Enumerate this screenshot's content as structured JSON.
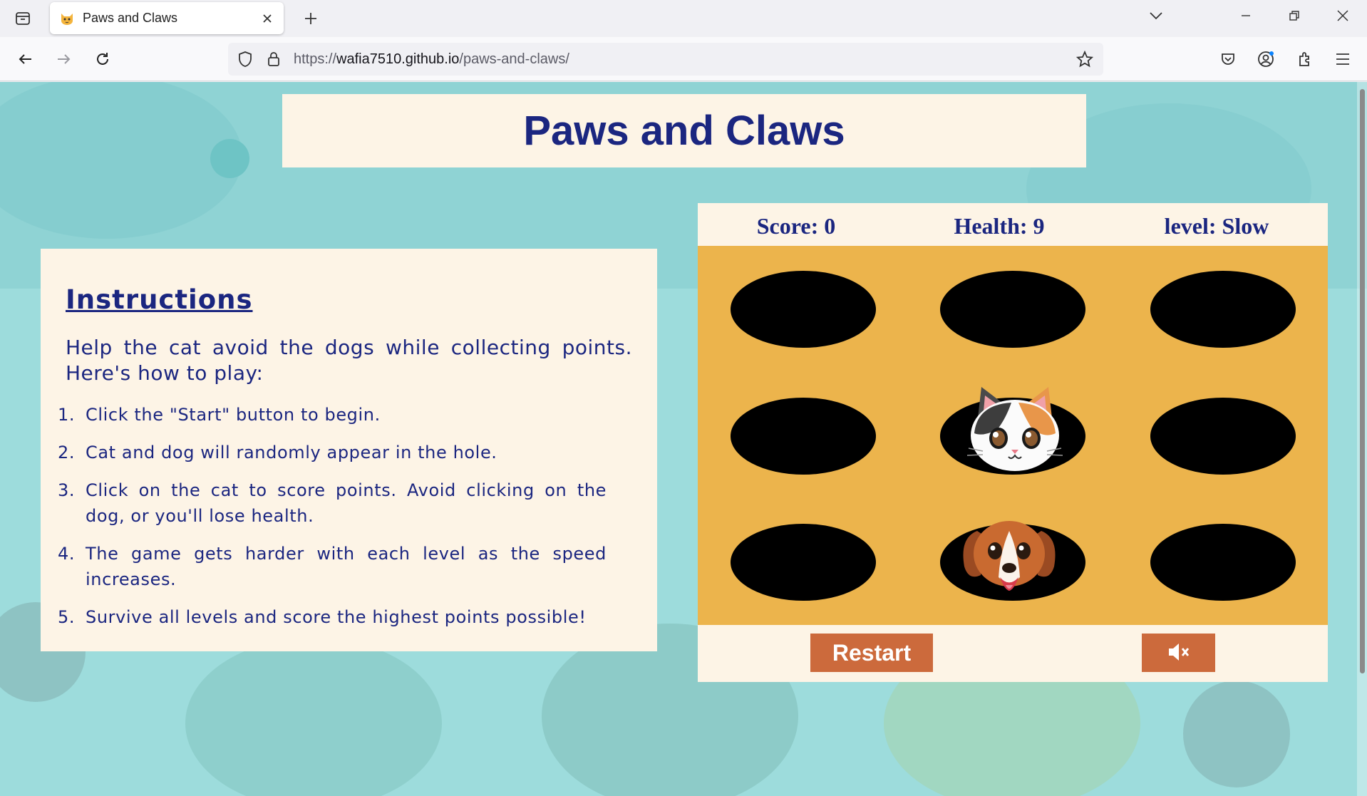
{
  "browser": {
    "tab_title": "Paws and Claws",
    "url_prefix": "https://",
    "url_host": "wafia7510.github.io",
    "url_path": "/paws-and-claws/"
  },
  "page": {
    "title": "Paws and Claws",
    "instructions": {
      "heading": "Instructions",
      "intro": "Help the cat avoid the dogs while collecting points. Here's how to play:",
      "steps": [
        {
          "num": "1.",
          "text": "Click the \"Start\" button to begin."
        },
        {
          "num": "2.",
          "text": "Cat and dog will randomly appear in the hole."
        },
        {
          "num": "3.",
          "text": "Click on the cat to score points. Avoid clicking on the dog, or you'll lose health."
        },
        {
          "num": "4.",
          "text": "The game gets harder with each level as the speed increases."
        },
        {
          "num": "5.",
          "text": "Survive all levels and score the highest points possible!"
        }
      ]
    },
    "game": {
      "score_text": "Score: 0",
      "health_text": "Health: 9",
      "level_text": "level: Slow",
      "restart_label": "Restart",
      "mute_icon": "speaker-muted-icon",
      "grid": [
        [
          "empty",
          "empty",
          "empty"
        ],
        [
          "empty",
          "cat",
          "empty"
        ],
        [
          "empty",
          "dog",
          "empty"
        ]
      ]
    },
    "colors": {
      "title": "#1b2680",
      "board": "#ecb44c",
      "panel": "#fdf4e6",
      "button": "#cc6a3c",
      "background": "#9ddcdc"
    }
  }
}
